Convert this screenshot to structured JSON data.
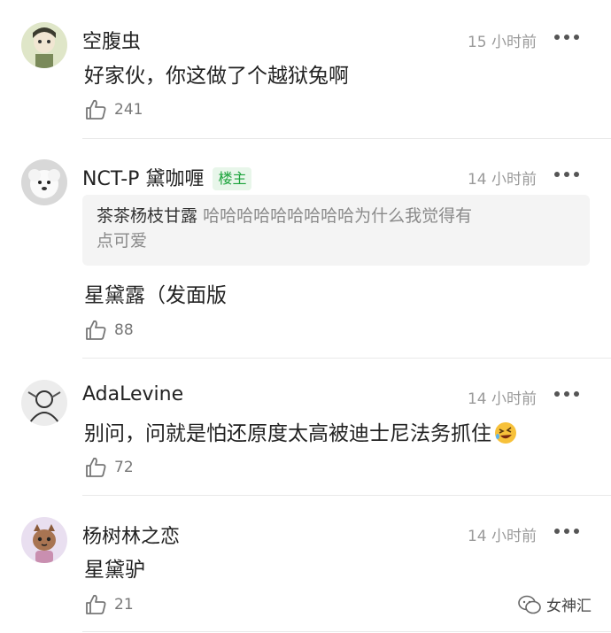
{
  "comments": [
    {
      "username": "空腹虫",
      "time": "15 小时前",
      "text": "好家伙，你这做了个越狱兔啊",
      "likes": "241",
      "avatar_icon": "cartoon-character-avatar"
    },
    {
      "username": "NCT-P 黛咖喱",
      "badge": "楼主",
      "time": "14 小时前",
      "quote_author": "茶茶杨枝甘露",
      "quote_text_line1": "哈哈哈哈哈哈哈哈哈为什么我觉得有",
      "quote_text_line2": "点可爱",
      "text": "星黛露（发面版",
      "likes": "88",
      "avatar_icon": "white-dog-avatar"
    },
    {
      "username": "AdaLevine",
      "time": "14 小时前",
      "text": "别问，问就是怕还原度太高被迪士尼法务抓住",
      "likes": "72",
      "avatar_icon": "sketch-avatar",
      "emoji": "rolling-laughing-emoji"
    },
    {
      "username": "杨树林之恋",
      "time": "14 小时前",
      "text": "星黛驴",
      "likes": "21",
      "avatar_icon": "cat-avatar"
    }
  ],
  "watermark": {
    "label": "女神汇",
    "icon": "wechat-icon"
  },
  "colors": {
    "badge_text": "#1aa33a",
    "badge_bg": "#e8f6ea",
    "meta_gray": "#9a9a9a"
  }
}
